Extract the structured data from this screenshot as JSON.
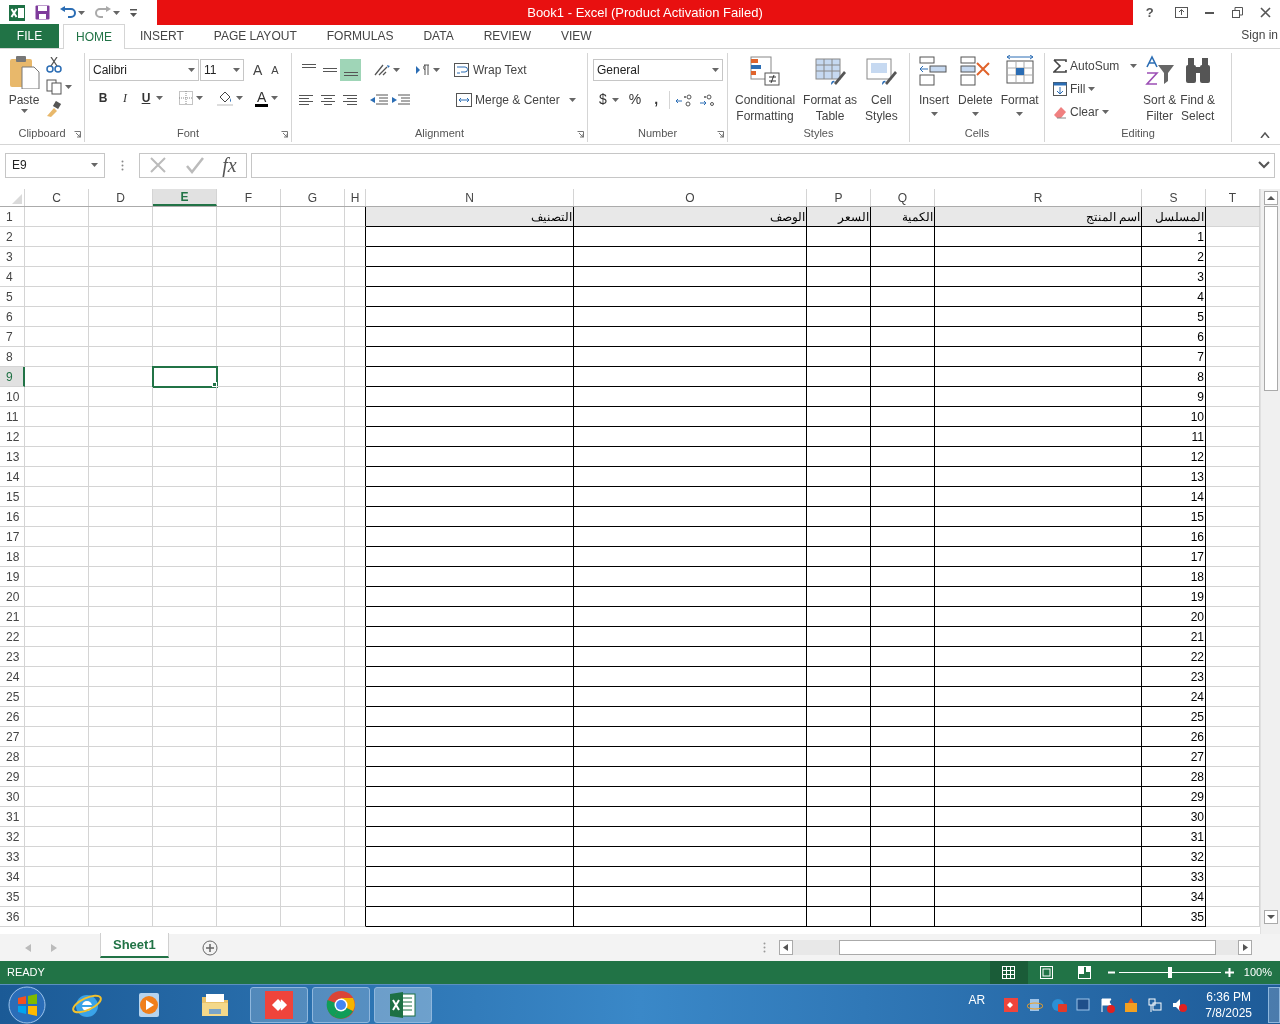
{
  "window": {
    "title": "Book1 -  Excel (Product Activation Failed)",
    "help": "?"
  },
  "ribbon_tabs": [
    {
      "label": "FILE",
      "kind": "file",
      "selected": false
    },
    {
      "label": "HOME",
      "kind": "tab",
      "selected": true
    },
    {
      "label": "INSERT",
      "kind": "tab",
      "selected": false
    },
    {
      "label": "PAGE LAYOUT",
      "kind": "tab",
      "selected": false
    },
    {
      "label": "FORMULAS",
      "kind": "tab",
      "selected": false
    },
    {
      "label": "DATA",
      "kind": "tab",
      "selected": false
    },
    {
      "label": "REVIEW",
      "kind": "tab",
      "selected": false
    },
    {
      "label": "VIEW",
      "kind": "tab",
      "selected": false
    }
  ],
  "account": "Sign in",
  "clipboard": {
    "label": "Clipboard",
    "paste": "Paste"
  },
  "font": {
    "label": "Font",
    "font_name": "Calibri",
    "font_size": "11",
    "grow": "A",
    "shrink": "A",
    "bold": "B",
    "italic": "I",
    "underline": "U",
    "font_color": "A"
  },
  "alignment": {
    "label": "Alignment",
    "vertical_align": [
      {
        "selected": false
      },
      {
        "selected": false
      },
      {
        "selected": true
      }
    ],
    "wrap_text": "Wrap Text",
    "merge_center": "Merge & Center"
  },
  "number": {
    "label": "Number",
    "format": "General",
    "currency": "$",
    "percent": "%",
    "comma": ","
  },
  "styles": {
    "label": "Styles",
    "buttons": [
      "Conditional Formatting",
      "Format as Table",
      "Cell Styles"
    ]
  },
  "cells": {
    "label": "Cells",
    "buttons": [
      "Insert",
      "Delete",
      "Format"
    ]
  },
  "editing": {
    "label": "Editing",
    "autosum": "AutoSum",
    "fill": "Fill",
    "clear": "Clear",
    "buttons": [
      "Sort & Filter",
      "Find & Select"
    ]
  },
  "formula_bar": {
    "name_box": "E9",
    "fx": "fx"
  },
  "columns": [
    {
      "label": "C",
      "selected": false
    },
    {
      "label": "D",
      "selected": false
    },
    {
      "label": "E",
      "selected": true
    },
    {
      "label": "F",
      "selected": false
    },
    {
      "label": "G",
      "selected": false
    },
    {
      "label": "H",
      "selected": false
    },
    {
      "label": "N",
      "selected": false
    },
    {
      "label": "O",
      "selected": false
    },
    {
      "label": "P",
      "selected": false
    },
    {
      "label": "Q",
      "selected": false
    },
    {
      "label": "R",
      "selected": false
    },
    {
      "label": "S",
      "selected": false
    },
    {
      "label": "T",
      "selected": false
    }
  ],
  "rows": [
    {
      "label": "1",
      "selected": false
    },
    {
      "label": "2",
      "selected": false
    },
    {
      "label": "3",
      "selected": false
    },
    {
      "label": "4",
      "selected": false
    },
    {
      "label": "5",
      "selected": false
    },
    {
      "label": "6",
      "selected": false
    },
    {
      "label": "7",
      "selected": false
    },
    {
      "label": "8",
      "selected": false
    },
    {
      "label": "9",
      "selected": true
    },
    {
      "label": "10",
      "selected": false
    },
    {
      "label": "11",
      "selected": false
    },
    {
      "label": "12",
      "selected": false
    },
    {
      "label": "13",
      "selected": false
    },
    {
      "label": "14",
      "selected": false
    },
    {
      "label": "15",
      "selected": false
    },
    {
      "label": "16",
      "selected": false
    },
    {
      "label": "17",
      "selected": false
    },
    {
      "label": "18",
      "selected": false
    },
    {
      "label": "19",
      "selected": false
    },
    {
      "label": "20",
      "selected": false
    },
    {
      "label": "21",
      "selected": false
    },
    {
      "label": "22",
      "selected": false
    },
    {
      "label": "23",
      "selected": false
    },
    {
      "label": "24",
      "selected": false
    },
    {
      "label": "25",
      "selected": false
    },
    {
      "label": "26",
      "selected": false
    },
    {
      "label": "27",
      "selected": false
    },
    {
      "label": "28",
      "selected": false
    },
    {
      "label": "29",
      "selected": false
    },
    {
      "label": "30",
      "selected": false
    },
    {
      "label": "31",
      "selected": false
    },
    {
      "label": "32",
      "selected": false
    },
    {
      "label": "33",
      "selected": false
    },
    {
      "label": "34",
      "selected": false
    },
    {
      "label": "35",
      "selected": false
    },
    {
      "label": "36",
      "selected": false
    }
  ],
  "table": {
    "header": [
      "المسلسل",
      "اسم المنتج",
      "الكمية",
      "السعر",
      "الوصف",
      "التصنيف"
    ],
    "serials": [
      "1",
      "2",
      "3",
      "4",
      "5",
      "6",
      "7",
      "8",
      "9",
      "10",
      "11",
      "12",
      "13",
      "14",
      "15",
      "16",
      "17",
      "18",
      "19",
      "20",
      "21",
      "22",
      "23",
      "24",
      "25",
      "26",
      "27",
      "28",
      "29",
      "30",
      "31",
      "32",
      "33",
      "34",
      "35"
    ]
  },
  "sheet_tabs": [
    {
      "label": "Sheet1",
      "selected": true
    }
  ],
  "status_bar": {
    "status": "READY",
    "zoom": "100%",
    "zoom_slider": {
      "level": 0.5
    }
  },
  "taskbar": {
    "language": "AR",
    "time": "6:36 PM",
    "date": "7/8/2025"
  }
}
